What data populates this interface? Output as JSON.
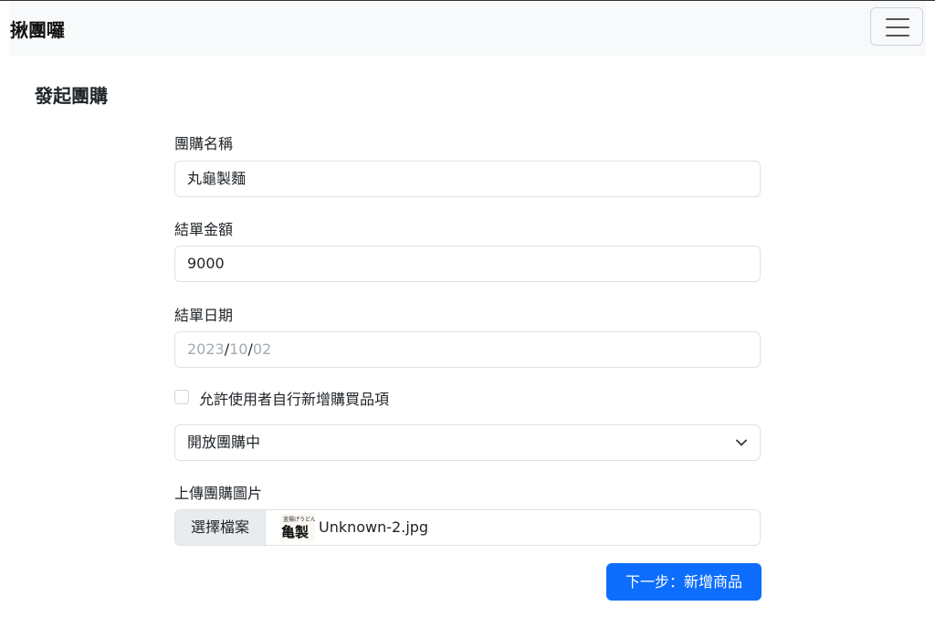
{
  "navbar": {
    "brand": "揪團囉",
    "menu_icon": "hamburger-menu-icon"
  },
  "page_title": "發起團購",
  "form": {
    "name": {
      "label": "團購名稱",
      "value": "丸龜製麵"
    },
    "amount": {
      "label": "結單金額",
      "value": "9000"
    },
    "date": {
      "label": "結單日期",
      "year": "2023",
      "month": "10",
      "day": "02",
      "separator": "/"
    },
    "allow_add_items": {
      "label": "允許使用者自行新增購買品項",
      "checked": false
    },
    "status": {
      "value": "開放團購中",
      "icon": "chevron-down-icon"
    },
    "image": {
      "label": "上傳團購圖片",
      "button": "選擇檔案",
      "file_name": "Unknown-2.jpg",
      "thumb_text_top": "釜揚げうどん",
      "thumb_text_main": "亀製"
    },
    "submit": "下一步：新增商品"
  },
  "colors": {
    "primary": "#0d6efd",
    "navbar_bg": "#f8f9fa",
    "border": "#dee2e6"
  }
}
